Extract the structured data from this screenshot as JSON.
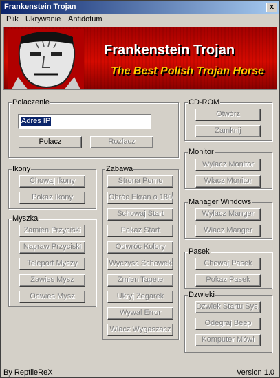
{
  "window": {
    "title": "Frankenstein Trojan",
    "close_glyph": "x"
  },
  "menu": {
    "items": [
      "Plik",
      "Ukrywanie",
      "Antidotum"
    ]
  },
  "banner": {
    "title": "Frankenstein Trojan",
    "subtitle": "The Best Polish Trojan Horse",
    "title_color": "#ffffff",
    "subtitle_color": "#ffd000",
    "background": "#c80000"
  },
  "polaczenie": {
    "label": "Polaczenie",
    "ip_value": "Adres IP",
    "connect_label": "Polacz",
    "disconnect_label": "Rozlacz"
  },
  "cdrom": {
    "label": "CD-ROM",
    "open_label": "Otwórz",
    "close_label": "Zamknij"
  },
  "monitor": {
    "label": "Monitor",
    "off_label": "Wylacz Monitor",
    "on_label": "Wlacz Monitor"
  },
  "manager": {
    "label": "Manager Windows",
    "off_label": "Wylacz Manger",
    "on_label": "Wlacz Manger"
  },
  "pasek": {
    "label": "Pasek",
    "hide_label": "Chowaj Pasek",
    "show_label": "Pokaz Pasek"
  },
  "dzwieki": {
    "label": "Dzwieki",
    "startup_label": "Dzwiek Startu Sys.",
    "beep_label": "Odegraj Beep",
    "speak_label": "Komputer Mówi"
  },
  "ikony": {
    "label": "Ikony",
    "hide_label": "Chowaj Ikony",
    "show_label": "Pokaz Ikony"
  },
  "myszka": {
    "label": "Myszka",
    "items": [
      "Zamien Przyciski",
      "Napraw Przyciski",
      "Teleport Myszy",
      "Zawies Mysz",
      "Odwies Mysz"
    ]
  },
  "zabawa": {
    "label": "Zabawa",
    "items": [
      "Strona Porno",
      "Obróc Ekran o 180",
      "Schowaj Start",
      "Pokaz Start",
      "Odwróc Kolory",
      "Wyczysc Schowek",
      "Zmien Tapete",
      "Ukryj Zegarek",
      "Wywal Error",
      "Wlacz Wygaszacz"
    ]
  },
  "footer": {
    "author": "By ReptileReX",
    "version": "Version 1.0"
  }
}
